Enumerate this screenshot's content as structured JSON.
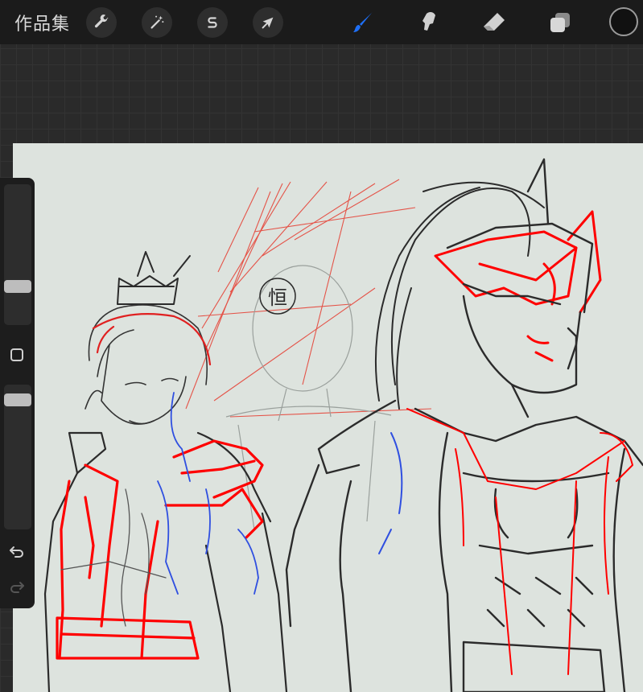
{
  "toolbar": {
    "gallery_label": "作品集",
    "left_tools": [
      "wrench-icon",
      "magic-wand-icon",
      "selection-s-icon",
      "transform-arrow-icon"
    ],
    "right_tools": [
      "brush-icon",
      "smudge-icon",
      "eraser-icon",
      "layers-icon"
    ],
    "active_tool": "brush-icon",
    "active_color": "#1e6ff5",
    "current_color": "#111111"
  },
  "sidebar": {
    "brush_size_level": 0.25,
    "opacity_level": 0.93
  },
  "canvas": {
    "background_color": "#dde3de",
    "seal_text": "恒"
  }
}
